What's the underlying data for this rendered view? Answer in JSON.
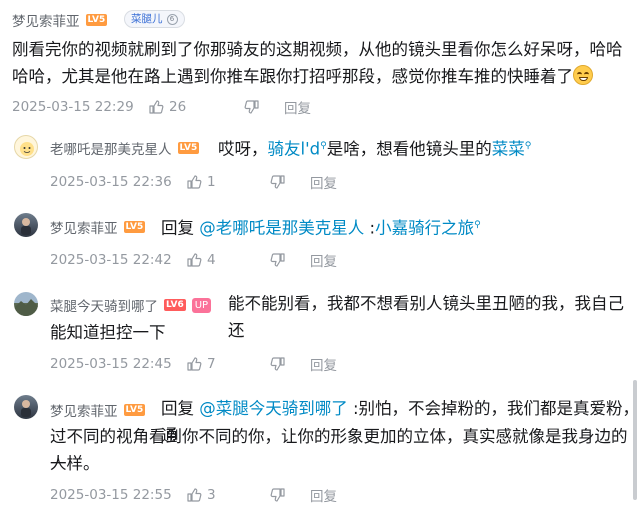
{
  "root": {
    "username": "梦见索菲亚",
    "level": "LV5",
    "fan_badge": "菜腿儿",
    "fan_level": "6",
    "text": "刚看完你的视频就刷到了你那骑友的这期视频，从他的镜头里看你怎么好呆呀，哈哈哈哈，尤其是他在路上遇到你推车跟你打招呼那段，感觉你推车推的快睡着了",
    "emoji": "laughing-face",
    "time": "2025-03-15 22:29",
    "likes": "26",
    "reply_label": "回复"
  },
  "replies": [
    {
      "username": "老哪吒是那美克星人",
      "level": "LV5",
      "text_a": "哎呀，",
      "link1": "骑友l'd",
      "text_b": "是啥，想看他镜头里的",
      "link2": "菜菜",
      "time": "2025-03-15 22:36",
      "likes": "1",
      "reply_label": "回复"
    },
    {
      "username": "梦见索菲亚",
      "level": "LV5",
      "reply_word": "回复",
      "mention": "@老哪吒是那美克星人",
      "sep": " :",
      "link1": "小嘉骑行之旅",
      "time": "2025-03-15 22:42",
      "likes": "4",
      "reply_label": "回复"
    },
    {
      "username": "菜腿今天骑到哪了",
      "level": "LV6",
      "up": "UP",
      "line1": "能不能别看，我都不想看别人镜头里丑陋的我，我自己还",
      "line2": "能知道担控一下",
      "time": "2025-03-15 22:45",
      "likes": "7",
      "reply_label": "回复"
    },
    {
      "username": "梦见索菲亚",
      "level": "LV5",
      "reply_word": "回复",
      "mention": "@菜腿今天骑到哪了",
      "line1": " :别怕，不会掉粉的，我们都是真爱粉，通",
      "line2": "过不同的视角看到你不同的你，让你的形象更加的立体，真实感就像是我身边的人",
      "line3": "一样。",
      "time": "2025-03-15 22:55",
      "likes": "3",
      "reply_label": "回复"
    }
  ]
}
